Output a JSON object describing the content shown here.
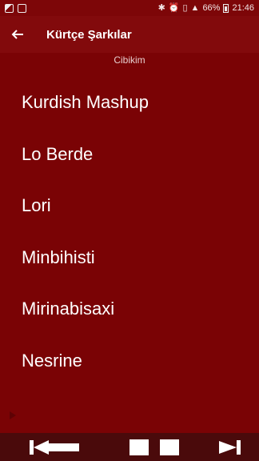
{
  "status_bar": {
    "battery": "66%",
    "time": "21:46"
  },
  "toolbar": {
    "title": "Kürtçe Şarkılar"
  },
  "subtitle": "Cibikim",
  "songs": [
    {
      "title": "Kurdish Mashup"
    },
    {
      "title": "Lo Berde"
    },
    {
      "title": "Lori"
    },
    {
      "title": "Minbihisti"
    },
    {
      "title": "Mirinabisaxi"
    },
    {
      "title": "Nesrine"
    }
  ],
  "controls": [
    "prev-icon",
    "stop-icon",
    "stop-icon",
    "next-icon"
  ]
}
